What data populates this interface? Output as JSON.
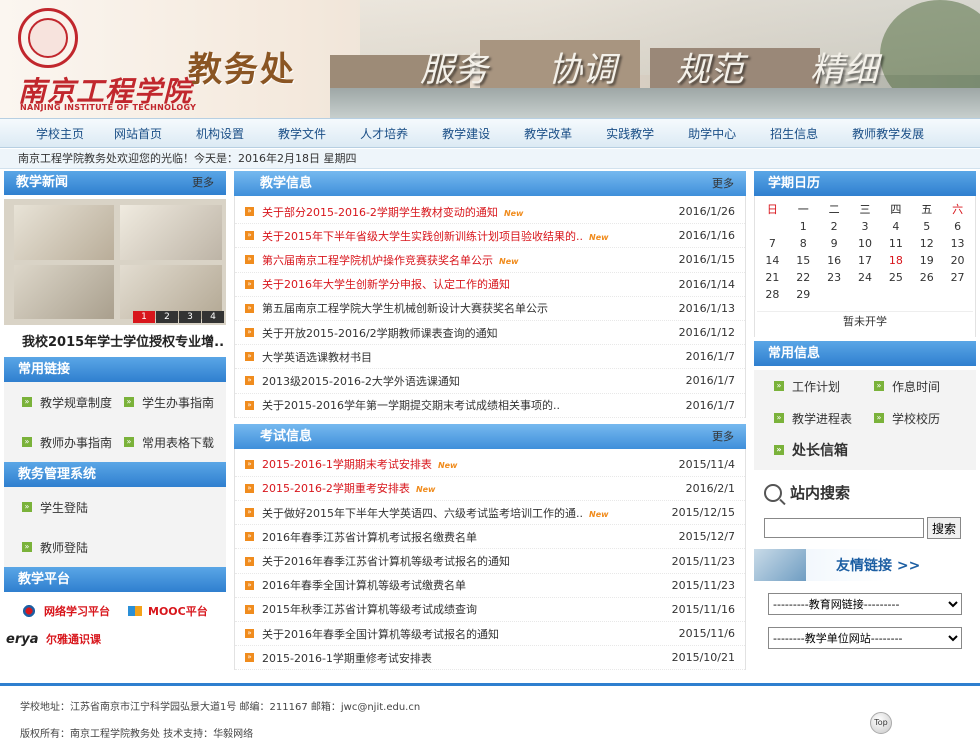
{
  "header": {
    "school_cn": "南京工程学院",
    "school_en": "NANJING INSTITUTE OF TECHNOLOGY",
    "office_title": "教务处",
    "slogans": [
      "服务",
      "协调",
      "规范",
      "精细"
    ]
  },
  "nav": [
    "学校主页",
    "网站首页",
    "机构设置",
    "教学文件",
    "人才培养",
    "教学建设",
    "教学改革",
    "实践教学",
    "助学中心",
    "招生信息",
    "教师教学发展"
  ],
  "welcome": "南京工程学院教务处欢迎您的光临！今天是：2016年2月18日 星期四",
  "news": {
    "title": "教学新闻",
    "more": "更多",
    "pager": [
      "1",
      "2",
      "3",
      "4"
    ],
    "caption": "我校2015年学士学位授权专业增.."
  },
  "common_links": {
    "title": "常用链接",
    "items": [
      "教学规章制度",
      "学生办事指南",
      "教师办事指南",
      "常用表格下载"
    ]
  },
  "admin_system": {
    "title": "教务管理系统",
    "items": [
      "学生登陆",
      "教师登陆"
    ]
  },
  "platform": {
    "title": "教学平台",
    "items": [
      "网络学习平台",
      "MOOC平台",
      "尔雅通识课"
    ],
    "erya_logo": "erya"
  },
  "teaching_info": {
    "title": "教学信息",
    "more": "更多",
    "new_badge": "New",
    "items": [
      {
        "title": "关于部分2015-2016-2学期学生教材变动的通知",
        "date": "2016/1/26",
        "red": true,
        "new": true
      },
      {
        "title": "关于2015年下半年省级大学生实践创新训练计划项目验收结果的..",
        "date": "2016/1/16",
        "red": true,
        "new": true
      },
      {
        "title": "第六届南京工程学院机炉操作竞赛获奖名单公示",
        "date": "2016/1/15",
        "red": true,
        "new": true
      },
      {
        "title": "关于2016年大学生创新学分申报、认定工作的通知",
        "date": "2016/1/14",
        "red": true,
        "new": false
      },
      {
        "title": "第五届南京工程学院大学生机械创新设计大赛获奖名单公示",
        "date": "2016/1/13",
        "red": false,
        "new": false
      },
      {
        "title": "关于开放2015-2016/2学期教师课表查询的通知",
        "date": "2016/1/12",
        "red": false,
        "new": false
      },
      {
        "title": "大学英语选课教材书目",
        "date": "2016/1/7",
        "red": false,
        "new": false
      },
      {
        "title": "2013级2015-2016-2大学外语选课通知",
        "date": "2016/1/7",
        "red": false,
        "new": false
      },
      {
        "title": "关于2015-2016学年第一学期提交期末考试成绩相关事项的..",
        "date": "2016/1/7",
        "red": false,
        "new": false
      }
    ]
  },
  "exam_info": {
    "title": "考试信息",
    "more": "更多",
    "new_badge": "New",
    "items": [
      {
        "title": "2015-2016-1学期期末考试安排表",
        "date": "2015/11/4",
        "red": true,
        "new": true
      },
      {
        "title": "2015-2016-2学期重考安排表",
        "date": "2016/2/1",
        "red": true,
        "new": true
      },
      {
        "title": "关于做好2015年下半年大学英语四、六级考试监考培训工作的通..",
        "date": "2015/12/15",
        "red": false,
        "new": true
      },
      {
        "title": "2016年春季江苏省计算机考试报名缴费名单",
        "date": "2015/12/7",
        "red": false,
        "new": false
      },
      {
        "title": "关于2016年春季江苏省计算机等级考试报名的通知",
        "date": "2015/11/23",
        "red": false,
        "new": false
      },
      {
        "title": "2016年春季全国计算机等级考试缴费名单",
        "date": "2015/11/23",
        "red": false,
        "new": false
      },
      {
        "title": "2015年秋季江苏省计算机等级考试成绩查询",
        "date": "2015/11/16",
        "red": false,
        "new": false
      },
      {
        "title": "关于2016年春季全国计算机等级考试报名的通知",
        "date": "2015/11/6",
        "red": false,
        "new": false
      },
      {
        "title": "2015-2016-1学期重修考试安排表",
        "date": "2015/10/21",
        "red": false,
        "new": false
      }
    ]
  },
  "calendar": {
    "title": "学期日历",
    "weekdays": [
      "日",
      "一",
      "二",
      "三",
      "四",
      "五",
      "六"
    ],
    "weeks": [
      [
        "",
        "1",
        "2",
        "3",
        "4",
        "5",
        "6"
      ],
      [
        "7",
        "8",
        "9",
        "10",
        "11",
        "12",
        "13"
      ],
      [
        "14",
        "15",
        "16",
        "17",
        "18",
        "19",
        "20"
      ],
      [
        "21",
        "22",
        "23",
        "24",
        "25",
        "26",
        "27"
      ],
      [
        "28",
        "29",
        "",
        "",
        "",
        "",
        ""
      ]
    ],
    "today": "18",
    "note": "暂未开学"
  },
  "common_info": {
    "title": "常用信息",
    "items": [
      "工作计划",
      "作息时间",
      "教学进程表",
      "学校校历"
    ],
    "mailbox": "处长信箱"
  },
  "search": {
    "title": "站内搜索",
    "placeholder": "",
    "button": "搜索"
  },
  "friend_links": {
    "title": "友情链接 >>",
    "select1": "---------教育网链接---------",
    "select2": "--------教学单位网站--------"
  },
  "footer": {
    "line1": "学校地址：江苏省南京市江宁科学园弘景大道1号  邮编：211167  邮箱：jwc@njit.edu.cn",
    "line2": "版权所有：南京工程学院教务处  技术支持：华毅网络",
    "top": "Top"
  }
}
